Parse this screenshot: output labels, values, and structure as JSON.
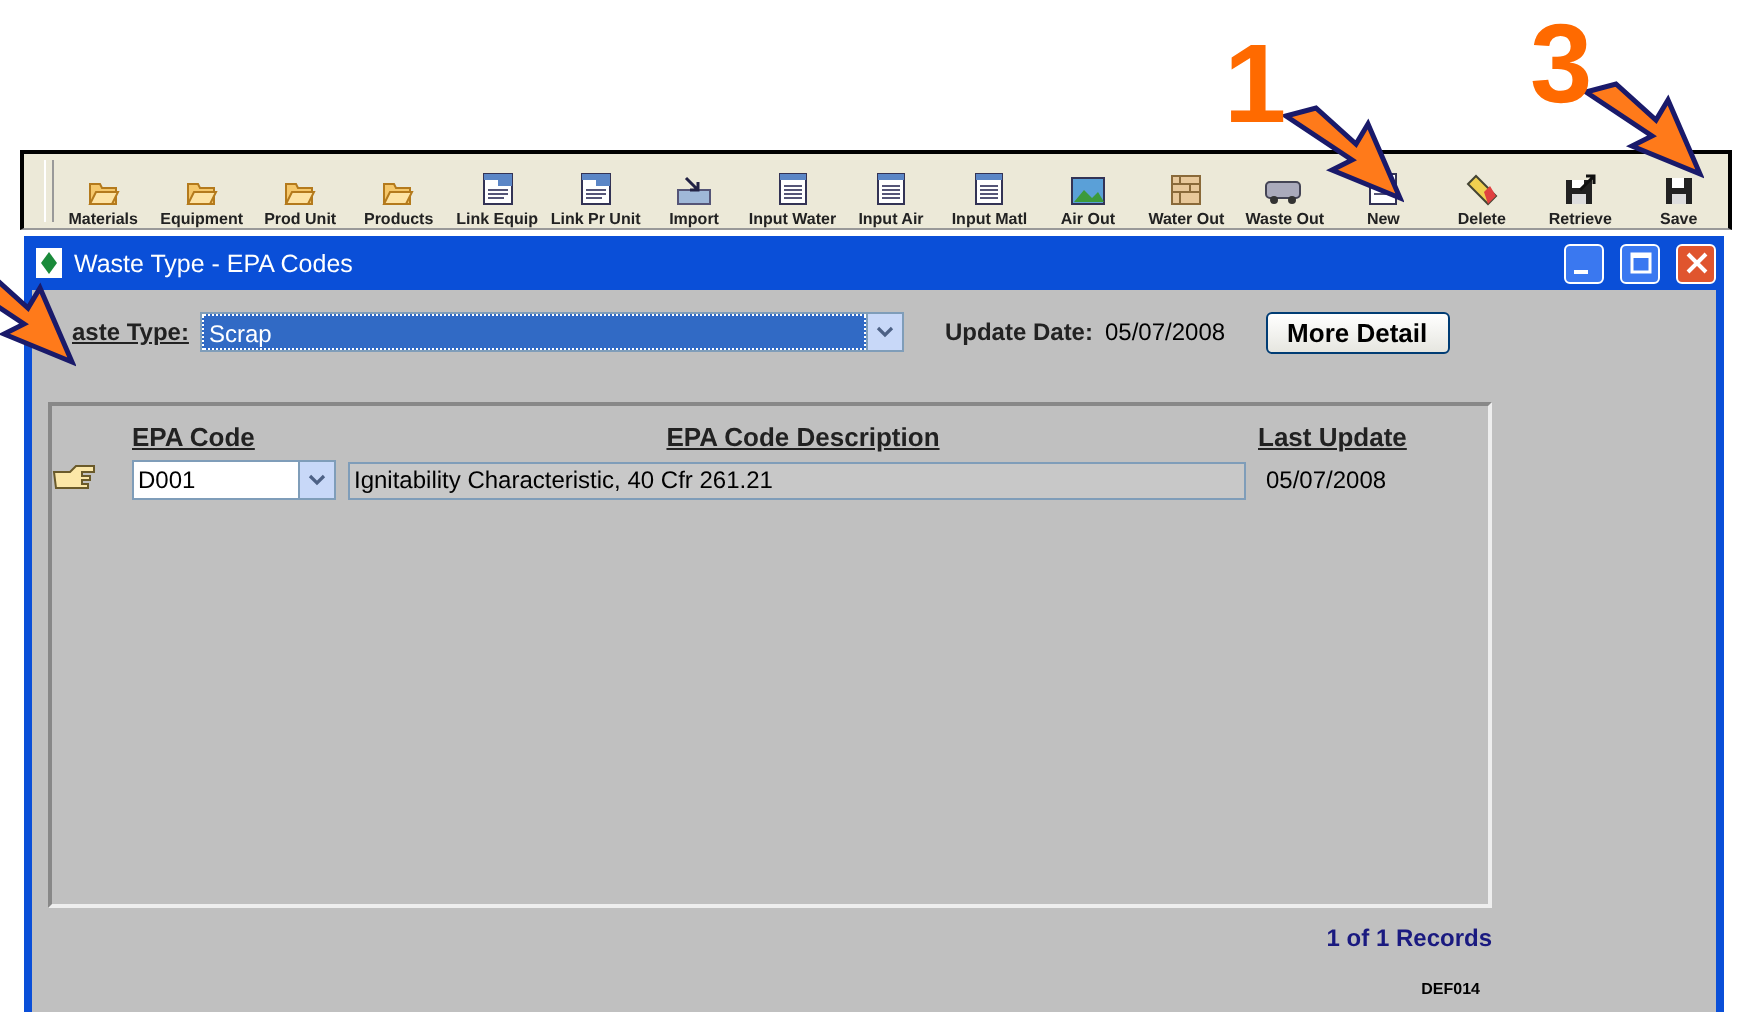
{
  "toolbar": {
    "items": [
      {
        "label": "Materials",
        "kind": "folder"
      },
      {
        "label": "Equipment",
        "kind": "folder"
      },
      {
        "label": "Prod Unit",
        "kind": "folder"
      },
      {
        "label": "Products",
        "kind": "folder"
      },
      {
        "label": "Link Equip",
        "kind": "form"
      },
      {
        "label": "Link Pr Unit",
        "kind": "form"
      },
      {
        "label": "Import",
        "kind": "import"
      },
      {
        "label": "Input Water",
        "kind": "doc"
      },
      {
        "label": "Input Air",
        "kind": "doc"
      },
      {
        "label": "Input Matl",
        "kind": "doc"
      },
      {
        "label": "Air Out",
        "kind": "picture"
      },
      {
        "label": "Water Out",
        "kind": "bricks"
      },
      {
        "label": "Waste Out",
        "kind": "truck"
      },
      {
        "label": "New",
        "kind": "new"
      },
      {
        "label": "Delete",
        "kind": "eraser"
      },
      {
        "label": "Retrieve",
        "kind": "retrieve"
      },
      {
        "label": "Save",
        "kind": "save"
      }
    ]
  },
  "window": {
    "title": "Waste Type - EPA Codes",
    "waste_type": {
      "label": "aste Type:",
      "value": "Scrap"
    },
    "update_date": {
      "label": "Update Date:",
      "value": "05/07/2008"
    },
    "more_detail_button": "More Detail",
    "table": {
      "columns": [
        "EPA Code",
        "EPA Code Description",
        "Last Update"
      ],
      "rows": [
        {
          "code": "D001",
          "description": "Ignitability Characteristic, 40 Cfr 261.21",
          "last_update": "05/07/2008",
          "current": true
        }
      ]
    },
    "record_count": "1 of 1 Records",
    "form_id": "DEF014"
  },
  "callouts": [
    {
      "kind": "numbered",
      "number": "1"
    },
    {
      "kind": "numbered",
      "number": "3"
    },
    {
      "kind": "arrow"
    }
  ]
}
